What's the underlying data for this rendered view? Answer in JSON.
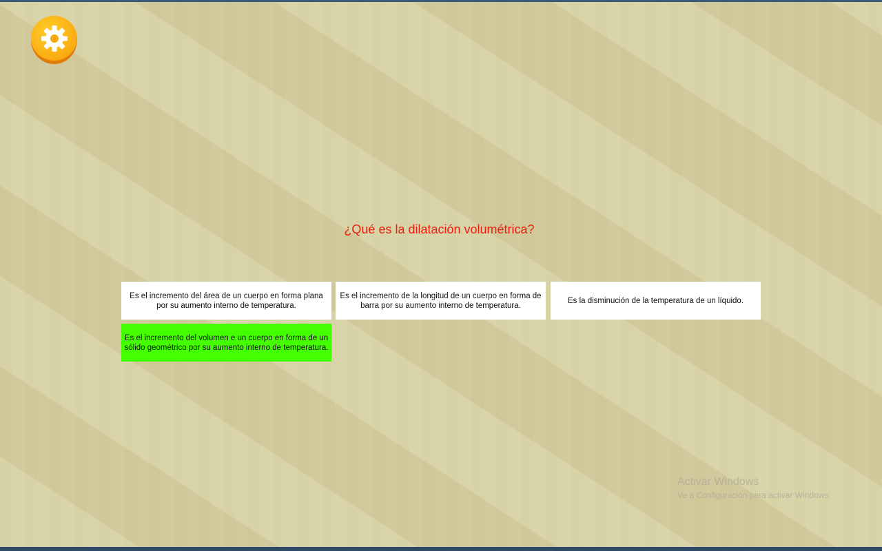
{
  "colors": {
    "question_text": "#e8200e",
    "correct_answer_bg": "#44ff00",
    "answer_bg": "#ffffff",
    "settings_button": "#fbb316"
  },
  "settings": {
    "icon": "gear-icon"
  },
  "question": {
    "text": "¿Qué es la dilatación volumétrica?"
  },
  "answers": [
    {
      "text": "Es el incremento del área de un cuerpo en forma plana por su aumento interno de temperatura.",
      "state": "default"
    },
    {
      "text": "Es el incremento de la longitud de un cuerpo en forma de barra por su aumento interno de temperatura.",
      "state": "default"
    },
    {
      "text": "Es la disminución de la temperatura de un líquido.",
      "state": "default"
    },
    {
      "text": "Es el incremento del volumen e un cuerpo en forma de un sólido geométrico por su aumento interno de temperatura.",
      "state": "correct"
    }
  ],
  "watermark": {
    "title": "Activar Windows",
    "subtitle": "Ve a Configuración para activar Windows."
  }
}
